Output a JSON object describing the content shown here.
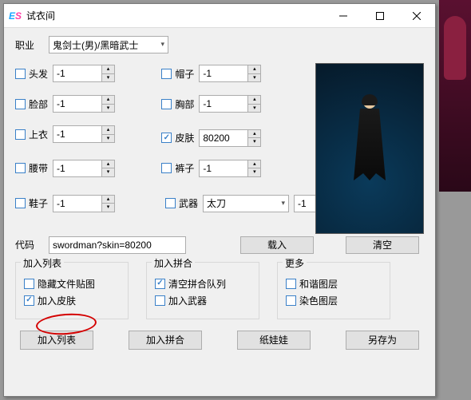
{
  "titlebar": {
    "title": "试衣间"
  },
  "labels": {
    "job": "职业",
    "hair": "头发",
    "hat": "帽子",
    "face": "脸部",
    "chest": "胸部",
    "coat": "上衣",
    "skin": "皮肤",
    "belt": "腰带",
    "pants": "裤子",
    "shoes": "鞋子",
    "weapon": "武器",
    "code": "代码"
  },
  "values": {
    "job": "鬼剑士(男)/黑暗武士",
    "hair": "-1",
    "hat": "-1",
    "face": "-1",
    "chest": "-1",
    "coat": "-1",
    "skin": "80200",
    "belt": "-1",
    "pants": "-1",
    "shoes": "-1",
    "weapon_type": "太刀",
    "weapon": "-1",
    "code": "swordman?skin=80200"
  },
  "buttons": {
    "load": "载入",
    "clear": "清空",
    "add_list": "加入列表",
    "add_merge": "加入拼合",
    "paper_doll": "纸娃娃",
    "save_as": "另存为"
  },
  "groups": {
    "add_list": {
      "title": "加入列表",
      "hide_file_image": "隐藏文件贴图",
      "add_skin": "加入皮肤"
    },
    "add_merge": {
      "title": "加入拼合",
      "clear_merge_queue": "清空拼合队列",
      "add_weapon": "加入武器"
    },
    "more": {
      "title": "更多",
      "harmony_layer": "和谐图层",
      "dye_layer": "染色图层"
    }
  }
}
